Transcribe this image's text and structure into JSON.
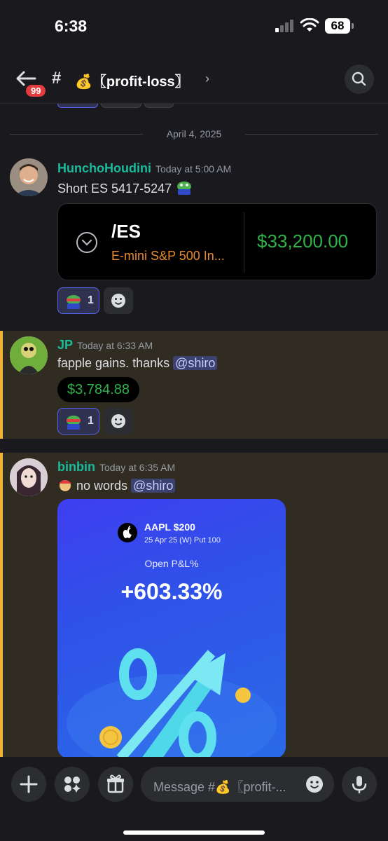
{
  "status_bar": {
    "time": "6:38",
    "battery": "68"
  },
  "header": {
    "unread_badge": "99",
    "hash": "#",
    "channel_name": "💰〖profit-loss〗",
    "chevron": "›"
  },
  "date_divider": "April 4, 2025",
  "messages": [
    {
      "author": "HunchoHoudini",
      "timestamp": "Today at 5:00 AM",
      "text": "Short ES 5417-5247",
      "embed": {
        "symbol": "/ES",
        "description": "E-mini S&P 500 In...",
        "price": "$33,200.00"
      },
      "reaction_count": "1"
    },
    {
      "author": "JP",
      "timestamp": "Today at 6:33 AM",
      "text": "fapple gains. thanks ",
      "mention": "@shiro",
      "pill": "$3,784.88",
      "reaction_count": "1"
    },
    {
      "author": "binbin",
      "timestamp": "Today at 6:35 AM",
      "text": "no words ",
      "mention": "@shiro",
      "card": {
        "ticker": "AAPL $200",
        "contract": "25 Apr 25 (W) Put 100",
        "pnl_label": "Open P&L%",
        "pnl_value": "+603.33%"
      }
    }
  ],
  "composer": {
    "placeholder": "Message #💰〖profit-..."
  },
  "colors": {
    "accent": "#5865f2",
    "highlight_bar": "#f0b232",
    "profit_green": "#2fb34a",
    "author": "#1abc9c"
  }
}
